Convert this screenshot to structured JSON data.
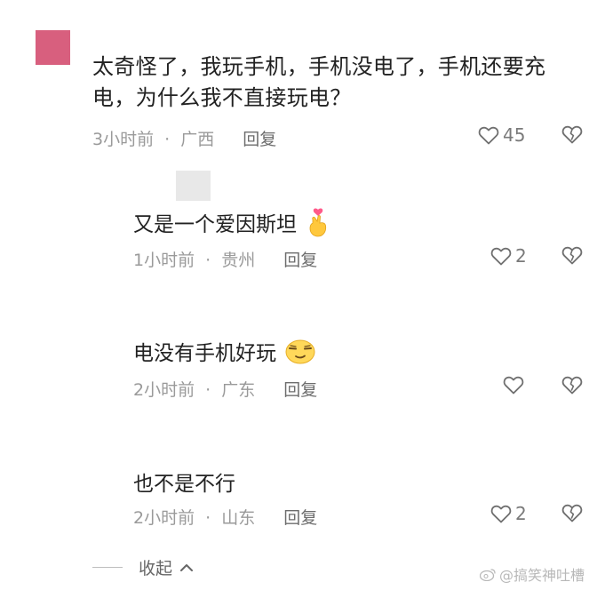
{
  "main_comment": {
    "text": "太奇怪了，我玩手机，手机没电了，手机还要充电，为什么我不直接玩电？",
    "time": "3小时前",
    "location": "广西",
    "reply_label": "回复",
    "likes": "45",
    "avatar_color": "#d85f7e"
  },
  "replies": [
    {
      "text": "又是一个爱因斯坦",
      "emoji": "finger-heart-emoji",
      "time": "1小时前",
      "location": "贵州",
      "reply_label": "回复",
      "likes": "2"
    },
    {
      "text": "电没有手机好玩",
      "emoji": "smirk-face-emoji",
      "time": "2小时前",
      "location": "广东",
      "reply_label": "回复",
      "likes": ""
    },
    {
      "text": "也不是不行",
      "emoji": "",
      "time": "2小时前",
      "location": "山东",
      "reply_label": "回复",
      "likes": "2"
    }
  ],
  "collapse_label": "收起",
  "watermark": "@搞笑神吐槽",
  "separator": "·"
}
